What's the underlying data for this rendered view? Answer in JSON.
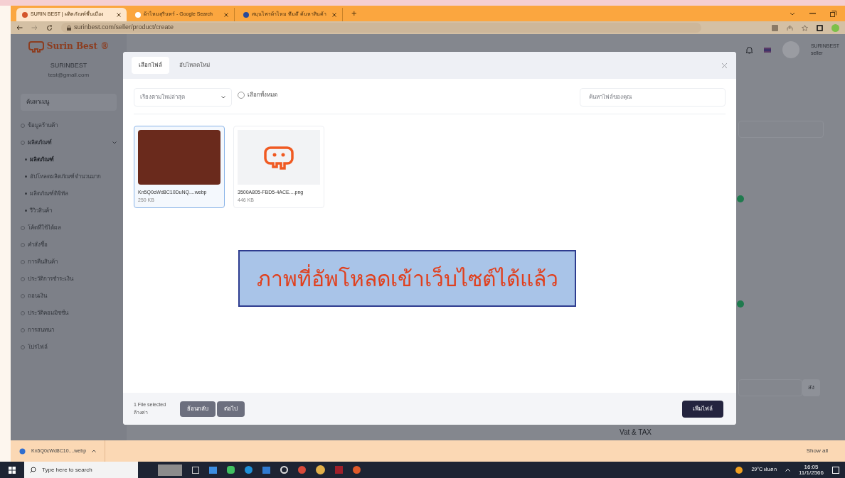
{
  "browser": {
    "tabs": [
      {
        "title": "SURIN BEST | ผลิตภัณฑ์พื้นเมือง",
        "selected": true
      },
      {
        "title": "ผ้าไหมสุรินทร์ - Google Search",
        "selected": false
      },
      {
        "title": "สมุนไพรผ้าไหม ทีมดี ค้นหาสินค้า",
        "selected": false
      }
    ],
    "new_tab": "+",
    "url": "surinbest.com/seller/product/create"
  },
  "sidebar": {
    "brand": "Surin Best",
    "brand_mark": "®",
    "user_name": "SURINBEST",
    "user_email": "test@gmail.com",
    "search_placeholder": "ค้นหาเมนู",
    "items": [
      {
        "label": "ข้อมูลร้านค้า",
        "selected": false
      },
      {
        "label": "ผลิตภัณฑ์",
        "selected": false,
        "expanded": true,
        "children": [
          {
            "label": "ผลิตภัณฑ์",
            "selected": true
          },
          {
            "label": "อัปโหลดผลิตภัณฑ์จำนวนมาก",
            "selected": false
          },
          {
            "label": "ผลิตภัณฑ์ดิจิทัล",
            "selected": false
          },
          {
            "label": "รีวิวสินค้า",
            "selected": false
          }
        ]
      },
      {
        "label": "โค้ดที่ใช้ได้ผล",
        "selected": false
      },
      {
        "label": "คำสั่งซื้อ",
        "selected": false
      },
      {
        "label": "การคืนสินค้า",
        "selected": false
      },
      {
        "label": "ประวัติการชำระเงิน",
        "selected": false
      },
      {
        "label": "ถอนเงิน",
        "selected": false
      },
      {
        "label": "ประวัติคอมมิชชั่น",
        "selected": false
      },
      {
        "label": "การสนทนา",
        "selected": false
      },
      {
        "label": "โปรไฟล์",
        "selected": false
      }
    ]
  },
  "header": {
    "user_name": "SURINBEST",
    "user_role": "seller"
  },
  "modal": {
    "tabs": [
      {
        "label": "เลือกไฟล์",
        "selected": true
      },
      {
        "label": "อัปโหลดใหม่",
        "selected": false
      }
    ],
    "sort": "เรียงตามใหม่ล่าสุด",
    "select_all": {
      "label": "เลือกทั้งหมด",
      "checked": false
    },
    "search_placeholder": "ค้นหาไฟล์ของคุณ",
    "files": [
      {
        "kind": "photo",
        "name": "Kn5Q0cWd8C10DuNQ....webp",
        "size": "250 KB",
        "selected": true
      },
      {
        "kind": "logo",
        "name": "3500A805-FBD5-4ACE....png",
        "size": "446 KB",
        "selected": false
      }
    ],
    "footer": {
      "selected_count": "1 File selected",
      "clear": "ล้างค่า",
      "prev": "ย้อนกลับ",
      "next": "ต่อไป",
      "add": "เพิ่มไฟล์"
    }
  },
  "caption": "ภาพที่อัพโหลดเข้าเว็บไซต์ได้แล้ว",
  "background": {
    "section_label": "Vat & TAX",
    "button": "ส่ง"
  },
  "download": {
    "file": "Kn5Q0cWd8C10....webp",
    "show_all": "Show all"
  },
  "taskbar": {
    "search_placeholder": "Type here to search",
    "weather": "29°C ฝนตก",
    "time": "16:05",
    "date": "11/1/2566"
  }
}
